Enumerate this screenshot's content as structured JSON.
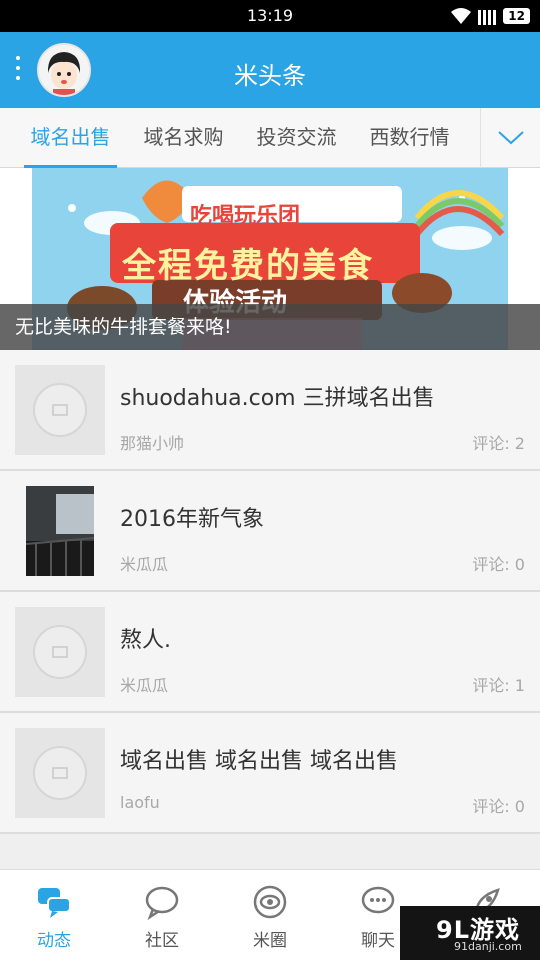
{
  "status_bar": {
    "time": "13:19",
    "battery": "12"
  },
  "header": {
    "title": "米头条"
  },
  "tabs": [
    {
      "label": "域名出售",
      "active": true
    },
    {
      "label": "域名求购",
      "active": false
    },
    {
      "label": "投资交流",
      "active": false
    },
    {
      "label": "西数行情",
      "active": false
    }
  ],
  "banner": {
    "top_line": "吃喝玩乐团",
    "headline": "全程免费的美食",
    "subline": "体验活动",
    "caption": "无比美味的牛排套餐来咯!"
  },
  "feed": [
    {
      "title": "shuodahua.com 三拼域名出售",
      "author": "那猫小帅",
      "comments": "评论: 2"
    },
    {
      "title": "2016年新气象",
      "author": "米瓜瓜",
      "comments": "评论: 0"
    },
    {
      "title": "熬人.",
      "author": "米瓜瓜",
      "comments": "评论: 1"
    },
    {
      "title": "域名出售 域名出售 域名出售",
      "author": "laofu",
      "comments": "评论: 0"
    }
  ],
  "bottom_nav": [
    {
      "label": "动态",
      "icon": "chat-bubbles-icon",
      "active": true
    },
    {
      "label": "社区",
      "icon": "speech-bubble-icon",
      "active": false
    },
    {
      "label": "米圈",
      "icon": "eye-circle-icon",
      "active": false
    },
    {
      "label": "聊天",
      "icon": "chat-dots-icon",
      "active": false
    },
    {
      "label": "",
      "icon": "rocket-icon",
      "active": false
    }
  ],
  "watermark": {
    "logo": "9L游戏",
    "url": "91danji.com"
  },
  "colors": {
    "accent": "#2ba4e5",
    "header_bg": "#2ba4e5"
  }
}
